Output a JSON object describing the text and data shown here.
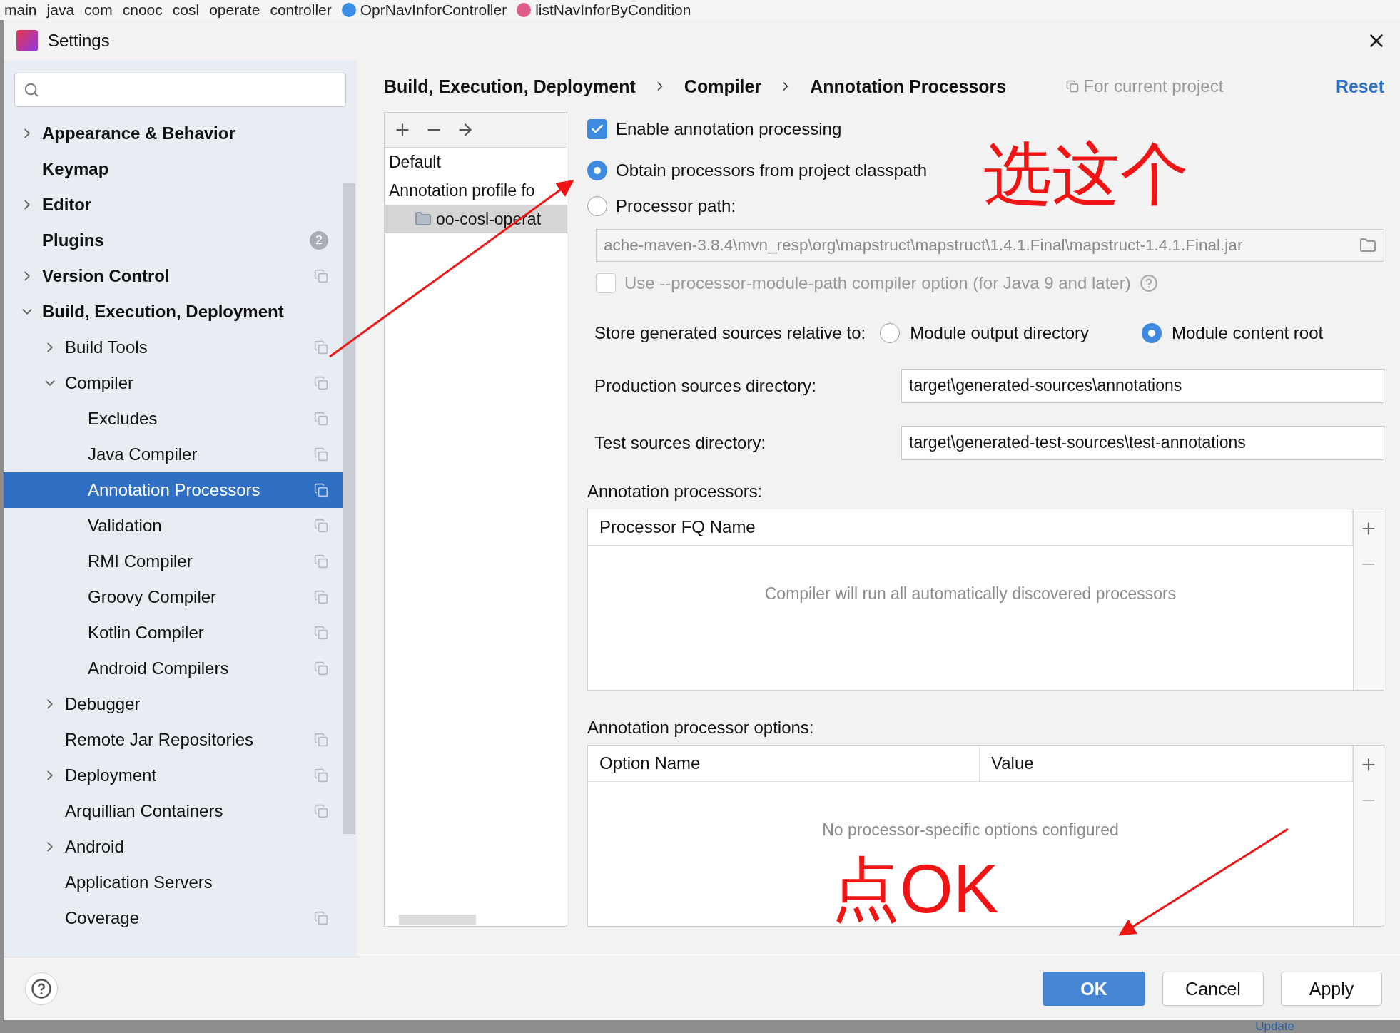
{
  "ide_breadcrumb": [
    {
      "label": "main",
      "kind": "plain"
    },
    {
      "label": "java",
      "kind": "plain"
    },
    {
      "label": "com",
      "kind": "plain"
    },
    {
      "label": "cnooc",
      "kind": "plain"
    },
    {
      "label": "cosl",
      "kind": "plain"
    },
    {
      "label": "operate",
      "kind": "plain"
    },
    {
      "label": "controller",
      "kind": "plain"
    },
    {
      "label": "OprNavInforController",
      "kind": "class"
    },
    {
      "label": "listNavInforByCondition",
      "kind": "method"
    }
  ],
  "window": {
    "title": "Settings"
  },
  "sidebar": {
    "items": [
      {
        "label": "Appearance & Behavior",
        "expanded": false,
        "selected": false,
        "scoped": false
      },
      {
        "label": "Keymap",
        "selected": false,
        "scoped": false
      },
      {
        "label": "Editor",
        "expanded": false,
        "selected": false,
        "scoped": false
      },
      {
        "label": "Plugins",
        "selected": false,
        "scoped": false,
        "badge": "2"
      },
      {
        "label": "Version Control",
        "expanded": false,
        "selected": false,
        "scoped": true
      },
      {
        "label": "Build, Execution, Deployment",
        "expanded": true,
        "selected": false,
        "scoped": false,
        "children": [
          {
            "label": "Build Tools",
            "expanded": false,
            "selected": false,
            "scoped": true
          },
          {
            "label": "Compiler",
            "expanded": true,
            "selected": false,
            "scoped": true,
            "children": [
              {
                "label": "Excludes",
                "selected": false,
                "scoped": true
              },
              {
                "label": "Java Compiler",
                "selected": false,
                "scoped": true
              },
              {
                "label": "Annotation Processors",
                "selected": true,
                "scoped": true
              },
              {
                "label": "Validation",
                "selected": false,
                "scoped": true
              },
              {
                "label": "RMI Compiler",
                "selected": false,
                "scoped": true
              },
              {
                "label": "Groovy Compiler",
                "selected": false,
                "scoped": true
              },
              {
                "label": "Kotlin Compiler",
                "selected": false,
                "scoped": true
              },
              {
                "label": "Android Compilers",
                "selected": false,
                "scoped": true
              }
            ]
          },
          {
            "label": "Debugger",
            "expanded": false,
            "selected": false,
            "scoped": false
          },
          {
            "label": "Remote Jar Repositories",
            "selected": false,
            "scoped": true
          },
          {
            "label": "Deployment",
            "expanded": false,
            "selected": false,
            "scoped": true
          },
          {
            "label": "Arquillian Containers",
            "selected": false,
            "scoped": true
          },
          {
            "label": "Android",
            "expanded": false,
            "selected": false,
            "scoped": false
          },
          {
            "label": "Application Servers",
            "selected": false,
            "scoped": false
          },
          {
            "label": "Coverage",
            "selected": false,
            "scoped": true
          }
        ]
      }
    ]
  },
  "header": {
    "path": [
      "Build, Execution, Deployment",
      "Compiler",
      "Annotation Processors"
    ],
    "scope_note": "For current project",
    "reset": "Reset"
  },
  "profiles": [
    {
      "label": "Default",
      "selected": false
    },
    {
      "label": "Annotation profile fo",
      "selected": false,
      "children": [
        {
          "label": "oo-cosl-operat",
          "selected": true
        }
      ]
    }
  ],
  "enable": {
    "label": "Enable annotation processing",
    "checked": true
  },
  "source": [
    {
      "label": "Obtain processors from project classpath",
      "selected": true
    },
    {
      "label": "Processor path:",
      "selected": false
    }
  ],
  "processor_path": {
    "value": "ache-maven-3.8.4\\mvn_resp\\org\\mapstruct\\mapstruct\\1.4.1.Final\\mapstruct-1.4.1.Final.jar",
    "disabled": true
  },
  "module_path": {
    "label": "Use --processor-module-path compiler option (for Java 9 and later)",
    "checked": false,
    "disabled": true
  },
  "store": {
    "label": "Store generated sources relative to:",
    "options": [
      {
        "label": "Module output directory",
        "selected": false
      },
      {
        "label": "Module content root",
        "selected": true
      }
    ]
  },
  "directories": [
    {
      "label": "Production sources directory:",
      "value": "target\\generated-sources\\annotations"
    },
    {
      "label": "Test sources directory:",
      "value": "target\\generated-test-sources\\test-annotations"
    }
  ],
  "tables": [
    {
      "title": "Annotation processors:",
      "columns": [
        "Processor FQ Name"
      ],
      "empty_text": "Compiler will run all automatically discovered processors"
    },
    {
      "title": "Annotation processor options:",
      "columns": [
        "Option Name",
        "Value"
      ],
      "empty_text": "No processor-specific options configured"
    }
  ],
  "buttons": [
    {
      "label": "OK",
      "kind": "primary"
    },
    {
      "label": "Cancel",
      "kind": "default"
    },
    {
      "label": "Apply",
      "kind": "default"
    }
  ],
  "notes": [
    {
      "text": "选这个"
    },
    {
      "text": "点OK"
    }
  ],
  "background": {
    "link": "Update"
  }
}
